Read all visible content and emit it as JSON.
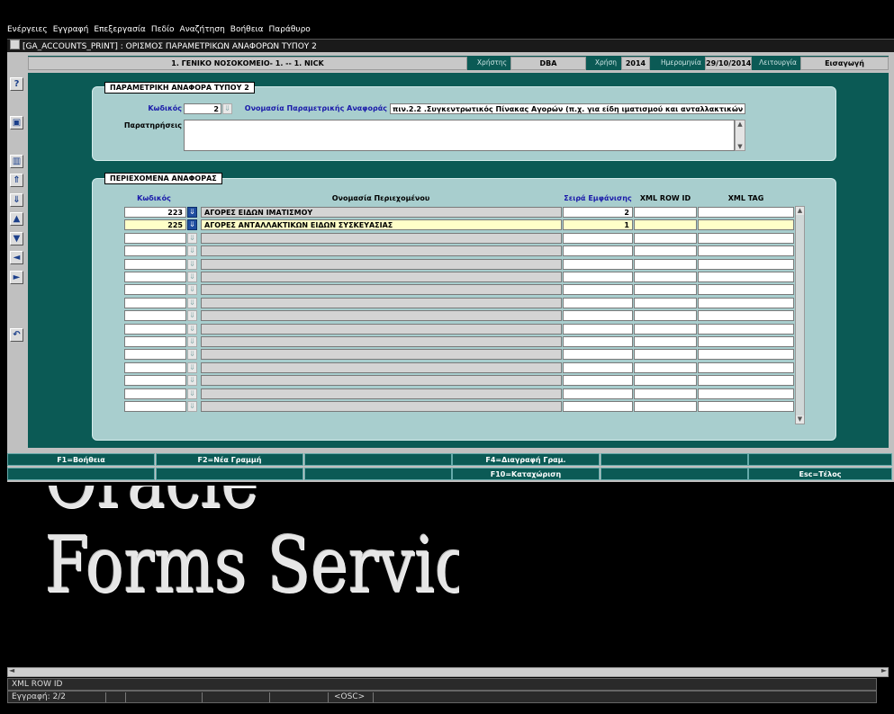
{
  "menu": [
    "Ενέργειες",
    "Εγγραφή",
    "Επεξεργασία",
    "Πεδίο",
    "Αναζήτηση",
    "Βοήθεια",
    "Παράθυρο"
  ],
  "window_title": "[GA_ACCOUNTS_PRINT]  :  ΟΡΙΣΜΟΣ ΠΑΡΑΜΕΤΡΙΚΩΝ ΑΝΑΦΟΡΩΝ ΤΥΠΟΥ 2",
  "infobar": {
    "org": "1. ΓΕΝΙΚΟ ΝΟΣΟΚΟΜΕΙΟ- 1. -- 1. NICK",
    "user_label": "Χρήστης",
    "user": "DBA",
    "year_label": "Χρήση",
    "year": "2014",
    "date_label": "Ημερομηνία",
    "date": "29/10/2014",
    "mode_label": "Λειτουργία",
    "mode": "Εισαγωγή"
  },
  "toolbar": [
    "help-icon",
    "save-icon",
    "delete-icon",
    "first-record-icon",
    "last-record-icon",
    "previous-record-icon",
    "next-record-icon",
    "previous-block-icon",
    "next-block-icon",
    "exit-icon"
  ],
  "param_section": {
    "title": "ΠΑΡΑΜΕΤΡΙΚΗ ΑΝΑΦΟΡΑ ΤΥΠΟΥ 2",
    "code_label": "Κωδικός",
    "code_value": "2",
    "name_label": "Ονομασία Παραμετρικής Αναφοράς",
    "name_value": "πιν.2.2 .Συγκεντρωτικός Πίνακας Αγορών (π.χ. για είδη ιματισμού και ανταλλακτικών ειδών)",
    "notes_label": "Παρατηρήσεις",
    "notes_value": ""
  },
  "contents_section": {
    "title": "ΠΕΡΙΕΧΟΜΕΝΑ ΑΝΑΦΟΡΑΣ",
    "headers": {
      "code": "Κωδικός",
      "name": "Ονομασία Περιεχομένου",
      "order": "Σειρά Εμφάνισης",
      "xml_row_id": "XML ROW ID",
      "xml_tag": "XML TAG"
    },
    "rows": [
      {
        "code": "223",
        "name": "ΑΓΟΡΕΣ ΕΙΔΩΝ ΙΜΑΤΙΣΜΟΥ",
        "order": "2",
        "xml_row_id": "",
        "xml_tag": ""
      },
      {
        "code": "225",
        "name": "ΑΓΟΡΕΣ ΑΝΤΑΛΛΑΚΤΙΚΩΝ ΕΙΔΩΝ ΣΥΣΚΕΥΑΣΙΑΣ",
        "order": "1",
        "xml_row_id": "",
        "xml_tag": ""
      },
      {
        "code": "",
        "name": "",
        "order": "",
        "xml_row_id": "",
        "xml_tag": ""
      },
      {
        "code": "",
        "name": "",
        "order": "",
        "xml_row_id": "",
        "xml_tag": ""
      },
      {
        "code": "",
        "name": "",
        "order": "",
        "xml_row_id": "",
        "xml_tag": ""
      },
      {
        "code": "",
        "name": "",
        "order": "",
        "xml_row_id": "",
        "xml_tag": ""
      },
      {
        "code": "",
        "name": "",
        "order": "",
        "xml_row_id": "",
        "xml_tag": ""
      },
      {
        "code": "",
        "name": "",
        "order": "",
        "xml_row_id": "",
        "xml_tag": ""
      },
      {
        "code": "",
        "name": "",
        "order": "",
        "xml_row_id": "",
        "xml_tag": ""
      },
      {
        "code": "",
        "name": "",
        "order": "",
        "xml_row_id": "",
        "xml_tag": ""
      },
      {
        "code": "",
        "name": "",
        "order": "",
        "xml_row_id": "",
        "xml_tag": ""
      },
      {
        "code": "",
        "name": "",
        "order": "",
        "xml_row_id": "",
        "xml_tag": ""
      },
      {
        "code": "",
        "name": "",
        "order": "",
        "xml_row_id": "",
        "xml_tag": ""
      },
      {
        "code": "",
        "name": "",
        "order": "",
        "xml_row_id": "",
        "xml_tag": ""
      },
      {
        "code": "",
        "name": "",
        "order": "",
        "xml_row_id": "",
        "xml_tag": ""
      },
      {
        "code": "",
        "name": "",
        "order": "",
        "xml_row_id": "",
        "xml_tag": ""
      }
    ],
    "selected_row": 1
  },
  "fkeys": {
    "row1": [
      "F1=Βοήθεια",
      "F2=Νέα Γραμμή",
      "",
      "F4=Διαγραφή Γραμ.",
      "",
      ""
    ],
    "row2": [
      "",
      "",
      "",
      "F10=Καταχώριση",
      "",
      "Esc=Τέλος"
    ]
  },
  "watermark": [
    "Oracle",
    "Forms Services"
  ],
  "status": {
    "message": "XML ROW ID",
    "record": "Εγγραφή: 2/2",
    "osc": "<OSC>"
  },
  "colors": {
    "canvas": "#0b5a55",
    "section": "#a8cece",
    "selected_row": "#ffffc8"
  }
}
